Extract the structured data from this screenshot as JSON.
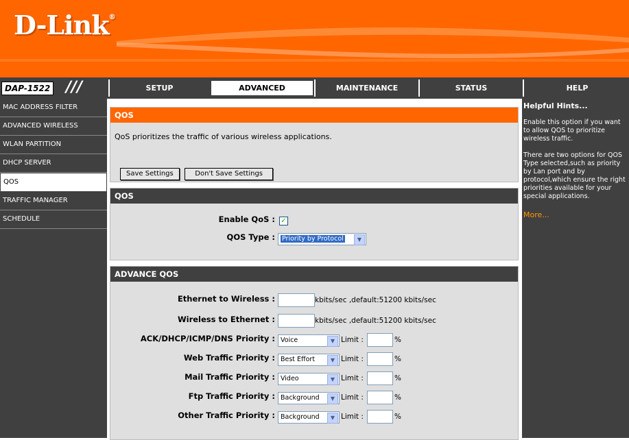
{
  "brand": {
    "logo_text": "D-Link",
    "registered": "®",
    "model": "DAP-1522",
    "model_slashes": "///"
  },
  "tabs": [
    {
      "label": "SETUP"
    },
    {
      "label": "ADVANCED"
    },
    {
      "label": "MAINTENANCE"
    },
    {
      "label": "STATUS"
    },
    {
      "label": "HELP"
    }
  ],
  "sidebar": {
    "items": [
      {
        "label": "MAC ADDRESS FILTER"
      },
      {
        "label": "ADVANCED WIRELESS"
      },
      {
        "label": "WLAN PARTITION"
      },
      {
        "label": "DHCP SERVER"
      },
      {
        "label": "QOS"
      },
      {
        "label": "TRAFFIC MANAGER"
      },
      {
        "label": "SCHEDULE"
      }
    ]
  },
  "intro": {
    "title": "QOS",
    "description": "QoS prioritizes the traffic of various wireless applications.",
    "save_label": "Save Settings",
    "dont_save_label": "Don't Save Settings"
  },
  "qos": {
    "title": "QOS",
    "enable_label": "Enable QoS :",
    "enable_checked": "✓",
    "type_label": "QOS Type :",
    "type_value": "Priority by Protocol"
  },
  "advance": {
    "title": "ADVANCE QOS",
    "eth_to_wireless_label": "Ethernet to Wireless :",
    "eth_to_wireless_value": "",
    "eth_to_wireless_suffix": "kbits/sec ,default:51200 kbits/sec",
    "wireless_to_eth_label": "Wireless to Ethernet :",
    "wireless_to_eth_value": "",
    "wireless_to_eth_suffix": "kbits/sec ,default:51200 kbits/sec",
    "limit_label": "Limit :",
    "percent": "%",
    "priorities": [
      {
        "label": "ACK/DHCP/ICMP/DNS Priority :",
        "value": "Voice"
      },
      {
        "label": "Web Traffic Priority :",
        "value": "Best Effort"
      },
      {
        "label": "Mail Traffic Priority :",
        "value": "Video"
      },
      {
        "label": "Ftp Traffic Priority :",
        "value": "Background"
      },
      {
        "label": "Other Traffic Priority :",
        "value": "Background"
      }
    ]
  },
  "hints": {
    "title": "Helpful Hints...",
    "p1": "Enable this option if you want to allow QOS to prioritize wireless traffic.",
    "p2": "There are two options for QOS Type selected,such as priority by Lan port and by protocol,which ensure the right priorities available for your special applications.",
    "more": "More..."
  },
  "colors": {
    "orange": "#ff6600",
    "dark": "#404040",
    "panel": "#dfdfdf"
  },
  "icons": {
    "dropdown": "chevron-down-icon",
    "checkbox": "checkmark-icon"
  }
}
